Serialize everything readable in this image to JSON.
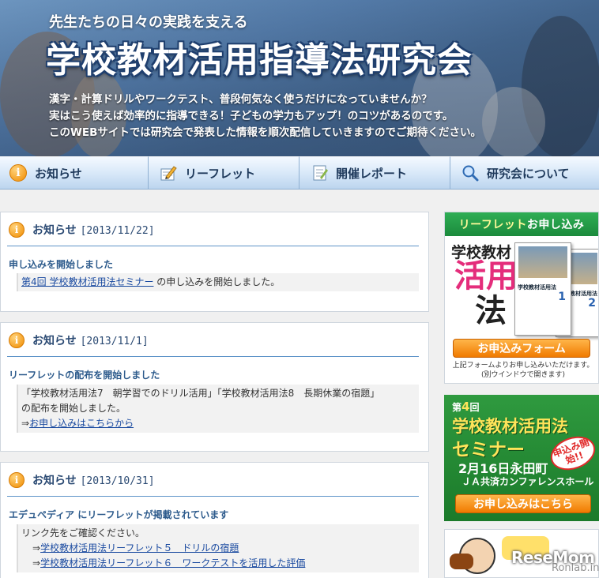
{
  "header": {
    "tagline": "先生たちの日々の実践を支える",
    "title": "学校教材活用指導法研究会",
    "intro": [
      "漢字・計算ドリルやワークテスト、普段何気なく使うだけになっていませんか？",
      "実はこう使えば効率的に指導できる！子どもの学力もアップ！のコツがあるのです。",
      "このWEBサイトでは研究会で発表した情報を順次配信していきますのでご期待ください。"
    ]
  },
  "nav": {
    "items": [
      {
        "label": "お知らせ",
        "icon": "info-icon"
      },
      {
        "label": "リーフレット",
        "icon": "pencil-icon"
      },
      {
        "label": "開催レポート",
        "icon": "document-icon"
      },
      {
        "label": "研究会について",
        "icon": "search-icon"
      }
    ]
  },
  "news": [
    {
      "heading": "お知らせ",
      "date": "[2013/11/22]",
      "subtitle": "申し込みを開始しました",
      "link": "第4回 学校教材活用法セミナー",
      "text": " の申し込みを開始しました。"
    },
    {
      "heading": "お知らせ",
      "date": "[2013/11/1]",
      "subtitle": "リーフレットの配布を開始しました",
      "line1": "「学校教材活用法7　朝学習でのドリル活用」「学校教材活用法8　長期休業の宿題」",
      "line2": "の配布を開始しました。",
      "arrow": "⇒",
      "link": "お申し込みはこちらから"
    },
    {
      "heading": "お知らせ",
      "date": "[2013/10/31]",
      "subtitle": "エデュペディア にリーフレットが掲載されています",
      "line1": "リンク先をご確認ください。",
      "arrow": "⇒",
      "link1": "学校教材活用法リーフレット５　ドリルの宿題",
      "link2": "学校教材活用法リーフレット６　ワークテストを活用した評価"
    }
  ],
  "sidebar": {
    "leaflet": {
      "bar_main": "リーフレット",
      "bar_sub": "お申し込み",
      "book_line1": "学校教材",
      "book_line2": "活用",
      "book_line3": "法",
      "book_cover_title": "学校教材活用法",
      "book1_num": "1",
      "book2_num": "2",
      "button": "お申込みフォーム",
      "note1": "上記フォームよりお申し込みいただけます。",
      "note2": "(別ウインドウで開きます)"
    },
    "seminar": {
      "num_prefix": "第",
      "num": "4",
      "num_suffix": "回",
      "title1": "学校教材活用法",
      "title2": "セミナー",
      "stamp": "申込み開始!!",
      "date": "2月16日永田町",
      "venue": "ＪＡ共済カンファレンスホール",
      "button": "お申し込みはこちら"
    }
  },
  "watermark": {
    "main": "ReseMom",
    "sub": "Ronlab.info"
  }
}
